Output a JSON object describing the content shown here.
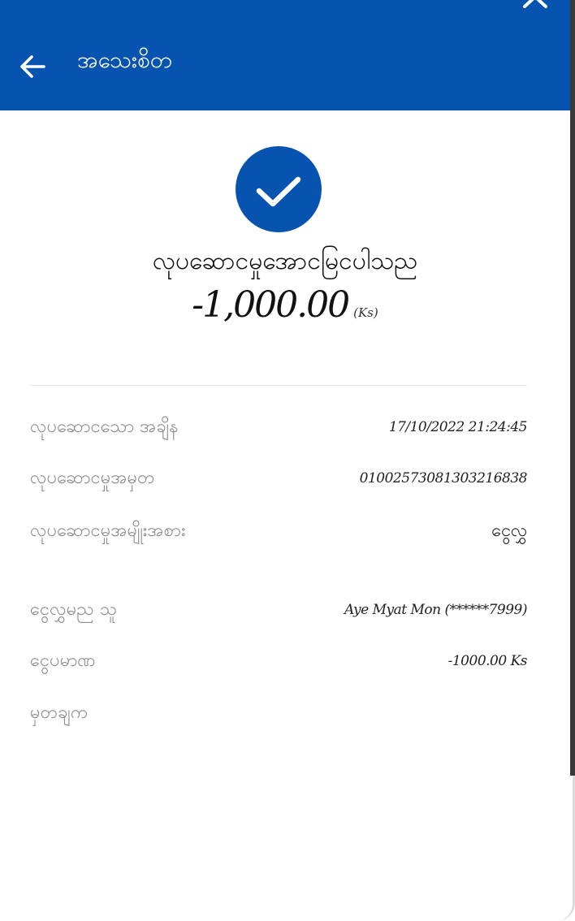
{
  "header": {
    "title": "အသေးစိတ",
    "back_icon": "arrow-left-icon",
    "close_icon": "close-icon",
    "background": "#0654b0"
  },
  "status": {
    "icon": "check-circle-icon",
    "message": "လုပဆောငမှုအောငမြငပါသည",
    "amount": "-1,000.00",
    "unit": "(Ks)"
  },
  "details": [
    {
      "label": "လုပဆောငသော အချိန",
      "value": "17/10/2022 21:24:45"
    },
    {
      "label": "လုပဆောငမှုအမှတ",
      "value": "01002573081303216838"
    },
    {
      "label": "လုပဆောငမှုအမျိုးအစား",
      "value": "ငွေလွှ"
    },
    {
      "label": "ငွေလွှမည သူ",
      "value": "Aye Myat Mon (******7999)"
    },
    {
      "label": "ငွေပမာဏ",
      "value": "-1000.00 Ks"
    },
    {
      "label": "မှတချက",
      "value": ""
    }
  ]
}
